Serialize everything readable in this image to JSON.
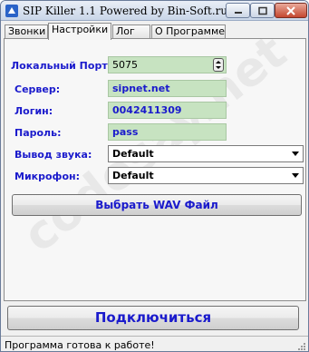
{
  "window": {
    "title": "SIP Killer 1.1 Powered by Bin-Soft.ru"
  },
  "tabs": [
    {
      "label": "Звонки",
      "active": false
    },
    {
      "label": "Настройки",
      "active": true
    },
    {
      "label": "Лог",
      "active": false
    },
    {
      "label": "О Программе",
      "active": false
    }
  ],
  "settings": {
    "port_label": "Локальный Порт:",
    "port_value": "5075",
    "server_label": "Сервер:",
    "server_value": "sipnet.net",
    "login_label": "Логин:",
    "login_value": "0042411309",
    "password_label": "Пароль:",
    "password_value": "pass",
    "audio_out_label": "Вывод звука:",
    "audio_out_value": "Default",
    "mic_label": "Микрофон:",
    "mic_value": "Default"
  },
  "buttons": {
    "wav_label": "Выбрать WAV Файл",
    "connect_label": "Подключиться"
  },
  "status": {
    "text": "Программа готова к работе!"
  },
  "watermark": {
    "text": "codesay.net"
  },
  "colors": {
    "label_blue": "#1a1acc",
    "field_green": "#c7e3c1",
    "close_red": "#c4472f"
  },
  "icons": [
    "app-icon",
    "minimize-icon",
    "maximize-icon",
    "close-icon",
    "spin-up-icon",
    "spin-down-icon",
    "dropdown-arrow-icon",
    "resize-grip-icon"
  ]
}
